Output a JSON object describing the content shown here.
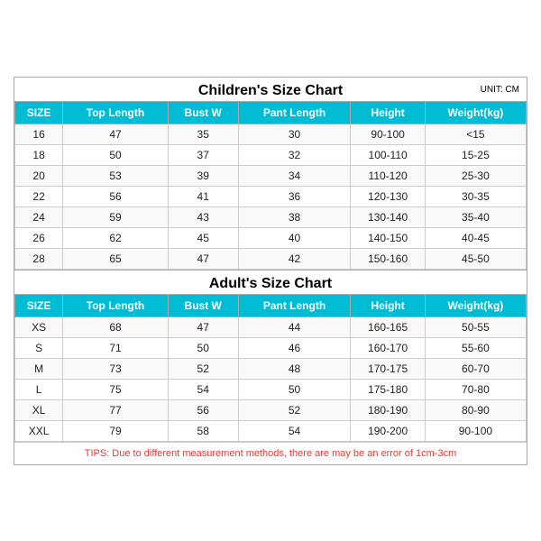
{
  "children_title": "Children's Size Chart",
  "adult_title": "Adult's Size Chart",
  "unit_label": "UNIT: CM",
  "headers": [
    "SIZE",
    "Top Length",
    "Bust W",
    "Pant Length",
    "Height",
    "Weight(kg)"
  ],
  "children_rows": [
    [
      "16",
      "47",
      "35",
      "30",
      "90-100",
      "<15"
    ],
    [
      "18",
      "50",
      "37",
      "32",
      "100-110",
      "15-25"
    ],
    [
      "20",
      "53",
      "39",
      "34",
      "110-120",
      "25-30"
    ],
    [
      "22",
      "56",
      "41",
      "36",
      "120-130",
      "30-35"
    ],
    [
      "24",
      "59",
      "43",
      "38",
      "130-140",
      "35-40"
    ],
    [
      "26",
      "62",
      "45",
      "40",
      "140-150",
      "40-45"
    ],
    [
      "28",
      "65",
      "47",
      "42",
      "150-160",
      "45-50"
    ]
  ],
  "adult_rows": [
    [
      "XS",
      "68",
      "47",
      "44",
      "160-165",
      "50-55"
    ],
    [
      "S",
      "71",
      "50",
      "46",
      "160-170",
      "55-60"
    ],
    [
      "M",
      "73",
      "52",
      "48",
      "170-175",
      "60-70"
    ],
    [
      "L",
      "75",
      "54",
      "50",
      "175-180",
      "70-80"
    ],
    [
      "XL",
      "77",
      "56",
      "52",
      "180-190",
      "80-90"
    ],
    [
      "XXL",
      "79",
      "58",
      "54",
      "190-200",
      "90-100"
    ]
  ],
  "tips": "TIPS: Due to different measurement methods, there are may be an error of 1cm-3cm"
}
